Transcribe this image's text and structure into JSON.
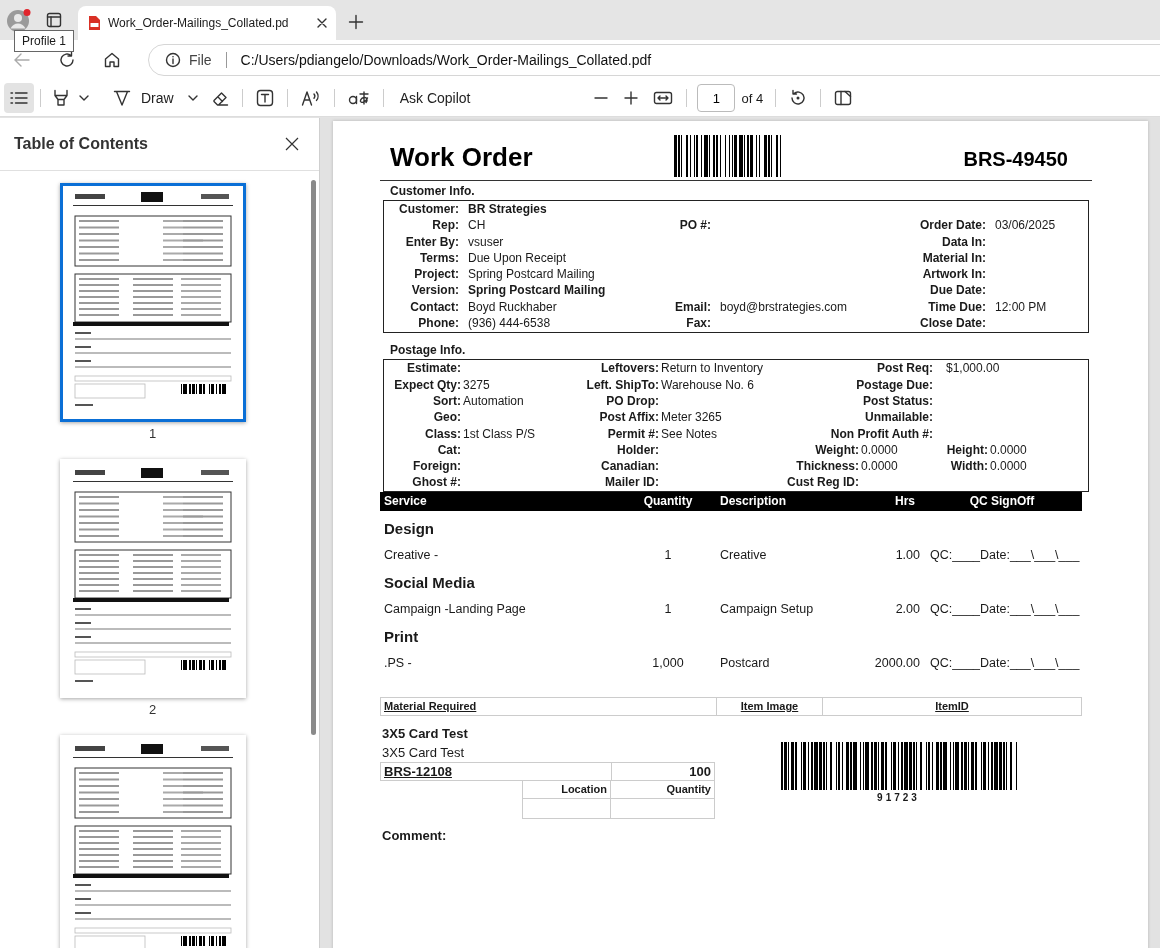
{
  "browser": {
    "profile_tooltip": "Profile 1",
    "tabs": [
      {
        "title": "Work_Order-Mailings_Collated.pd",
        "selected": true
      }
    ],
    "address_bar": {
      "scheme": "File",
      "url": "C:/Users/pdiangelo/Downloads/Work_Order-Mailings_Collated.pdf"
    }
  },
  "pdf_toolbar": {
    "contents_panel_on": true,
    "draw_label": "Draw",
    "copilot_label": "Ask Copilot",
    "page_number": "1",
    "page_count": "of 4"
  },
  "sidebar": {
    "title": "Table of Contents",
    "thumbnails": [
      {
        "label": "1",
        "selected": true
      },
      {
        "label": "2",
        "selected": false
      },
      {
        "selected": false
      }
    ]
  },
  "document": {
    "title": "Work Order",
    "order_number": "BRS-49450",
    "customer_info": {
      "heading": "Customer Info.",
      "rows": [
        {
          "left": {
            "label": "Customer:",
            "value": "BR Strategies",
            "bold": true
          }
        },
        {
          "left": {
            "label": "Rep:",
            "value": "CH",
            "bold": false
          },
          "middle": {
            "label": "PO #:"
          },
          "right": {
            "label": "Order Date:",
            "value": "03/06/2025",
            "bold": false
          }
        },
        {
          "left": {
            "label": "Enter By:",
            "value": "vsuser",
            "bold": false
          },
          "right": {
            "label": "Data In:"
          }
        },
        {
          "left": {
            "label": "Terms:",
            "value": "Due Upon Receipt",
            "bold": false
          },
          "right": {
            "label": "Material In:"
          }
        },
        {
          "left": {
            "label": "Project:",
            "value": "Spring Postcard Mailing",
            "bold": false
          },
          "right": {
            "label": "Artwork In:"
          }
        },
        {
          "left": {
            "label": "Version:",
            "value": "Spring Postcard Mailing",
            "bold": true
          },
          "right": {
            "label": "Due Date:"
          }
        },
        {
          "left": {
            "label": "Contact:",
            "value": "Boyd Ruckhaber",
            "bold": false
          },
          "middle": {
            "label": "Email:",
            "value": "boyd@brstrategies.com",
            "bold": false
          },
          "right": {
            "label": "Time Due:",
            "value": "12:00 PM",
            "bold": false
          }
        },
        {
          "left": {
            "label": "Phone:",
            "value": "(936) 444-6538",
            "bold": false
          },
          "middle": {
            "label": "Fax:"
          },
          "right": {
            "label": "Close Date:"
          }
        }
      ]
    },
    "postage_info": {
      "heading": "Postage Info.",
      "rows": [
        {
          "kind": "wide",
          "fields": [
            {
              "label": "Estimate:"
            },
            {
              "label": "Leftovers:",
              "value": "Return to Inventory"
            },
            {
              "label": "Post Req:",
              "value": "$1,000.00"
            }
          ]
        },
        {
          "kind": "wide",
          "fields": [
            {
              "label": "Expect Qty:",
              "value": "3275"
            },
            {
              "label": "Left. ShipTo:",
              "value": "Warehouse No. 6"
            },
            {
              "label": "Postage Due:"
            }
          ]
        },
        {
          "kind": "wide",
          "fields": [
            {
              "label": "Sort:",
              "value": "Automation"
            },
            {
              "label": "PO Drop:"
            },
            {
              "label": "Post Status:"
            }
          ]
        },
        {
          "kind": "wide",
          "fields": [
            {
              "label": "Geo:"
            },
            {
              "label": "Post Affix:",
              "value": "Meter 3265"
            },
            {
              "label": "Unmailable:"
            }
          ]
        },
        {
          "kind": "wide",
          "fields": [
            {
              "label": "Class:",
              "value": "1st Class P/S"
            },
            {
              "label": "Permit #:",
              "value": "See Notes"
            },
            {
              "label": "Non Profit Auth #:"
            }
          ]
        },
        {
          "kind": "split",
          "fields": [
            {
              "label": "Cat:"
            },
            {
              "label": "Holder:"
            },
            {
              "label": "Weight:",
              "value": "0.0000"
            },
            {
              "label": "Height:",
              "value": "0.0000"
            }
          ]
        },
        {
          "kind": "split",
          "fields": [
            {
              "label": "Foreign:"
            },
            {
              "label": "Canadian:"
            },
            {
              "label": "Thickness:",
              "value": "0.0000"
            },
            {
              "label": "Width:",
              "value": "0.0000"
            }
          ]
        },
        {
          "kind": "split",
          "fields": [
            {
              "label": "Ghost #:"
            },
            {
              "label": "Mailer ID:"
            },
            {
              "label": "Cust Reg ID:"
            }
          ]
        }
      ]
    },
    "services": {
      "columns": [
        "Service",
        "Quantity",
        "Description",
        "Hrs",
        "QC SignOff"
      ],
      "groups": [
        {
          "name": "Design",
          "rows": [
            [
              "Creative -",
              "1",
              "Creative",
              "1.00",
              "QC:____Date:___\\___\\___"
            ]
          ]
        },
        {
          "name": "Social Media",
          "rows": [
            [
              "Campaign -Landing Page",
              "1",
              "Campaign Setup",
              "2.00",
              "QC:____Date:___\\___\\___"
            ]
          ]
        },
        {
          "name": "Print",
          "rows": [
            [
              ".PS -",
              "1,000",
              "Postcard",
              "2000.00",
              "QC:____Date:___\\___\\___"
            ]
          ]
        }
      ]
    },
    "materials": {
      "columns": [
        "Material Required",
        "Item Image",
        "ItemID"
      ],
      "items": [
        {
          "name": "3X5 Card Test",
          "description": "3X5 Card Test",
          "code": "BRS-12108",
          "quantity": "100",
          "stock_columns": [
            "Location",
            "Quantity"
          ],
          "barcode_number": "91723"
        }
      ]
    },
    "comment_label": "Comment:"
  }
}
